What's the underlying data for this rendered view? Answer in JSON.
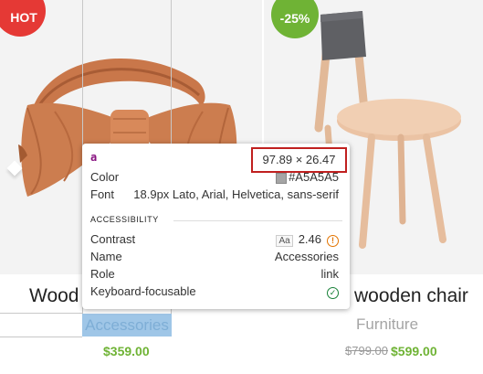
{
  "products": [
    {
      "badge": "HOT",
      "title": "Wood",
      "category": "Accessories",
      "price": "$359.00"
    },
    {
      "badge": "-25%",
      "title": "wooden chair",
      "category": "Furniture",
      "old_price": "$799.00",
      "price": "$599.00"
    }
  ],
  "inspector": {
    "tag": "a",
    "dimensions": "97.89 × 26.47",
    "color_label": "Color",
    "color_value": "#A5A5A5",
    "font_label": "Font",
    "font_value": "18.9px Lato, Arial, Helvetica, sans-serif",
    "section": "ACCESSIBILITY",
    "contrast_label": "Contrast",
    "contrast_icon": "Aa",
    "contrast_value": "2.46",
    "name_label": "Name",
    "name_value": "Accessories",
    "role_label": "Role",
    "role_value": "link",
    "keyboard_label": "Keyboard-focusable"
  },
  "colors": {
    "hot": "#e53935",
    "sale": "#6fb335",
    "highlight": "#9fc6e7",
    "outline": "#c0201f"
  },
  "icons": {
    "warning": "warning-icon",
    "check": "check-circle-icon"
  }
}
